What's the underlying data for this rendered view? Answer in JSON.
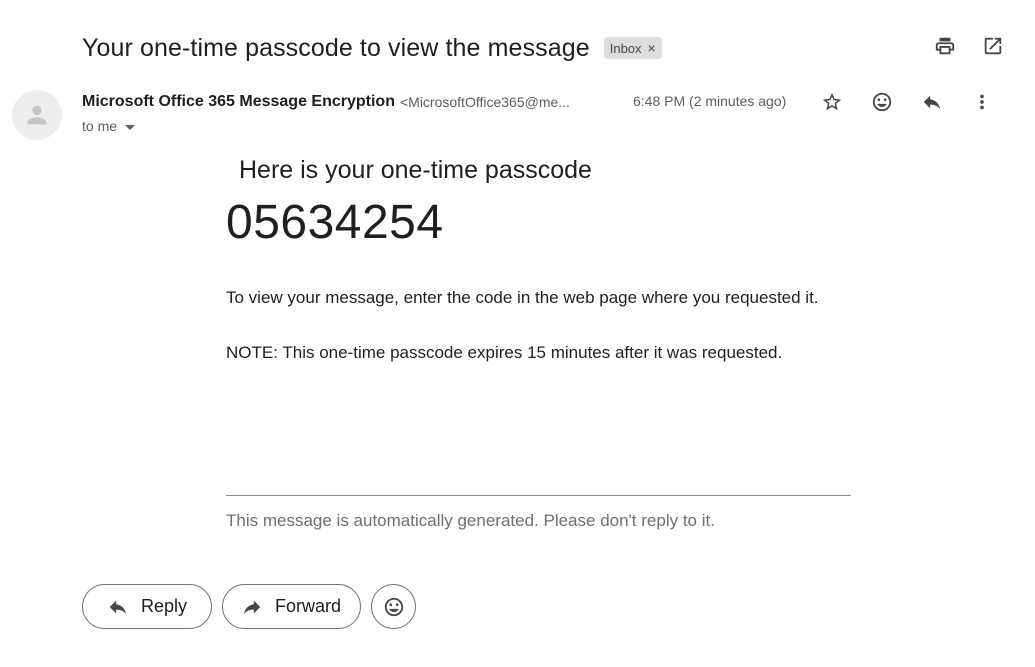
{
  "subject": "Your one-time passcode to view the message",
  "label": {
    "name": "Inbox",
    "remove": "×"
  },
  "top_actions": [
    "print-icon",
    "open-in-new-window-icon"
  ],
  "sender": {
    "name": "Microsoft Office 365 Message Encryption",
    "email": "<MicrosoftOffice365@me...",
    "time": "6:48 PM (2 minutes ago)",
    "to": "to me"
  },
  "message_actions": [
    "star-icon",
    "emoji-icon",
    "reply-icon",
    "more-vert-icon"
  ],
  "body": {
    "heading": "Here is your one-time passcode",
    "code": "05634254",
    "instruction": "To view your message, enter the code in the web page where you requested it.",
    "note": "NOTE: This one-time passcode expires 15 minutes after it was requested.",
    "footer": "This message is automatically generated. Please don't reply to it."
  },
  "reply_bar": {
    "reply": "Reply",
    "forward": "Forward"
  }
}
